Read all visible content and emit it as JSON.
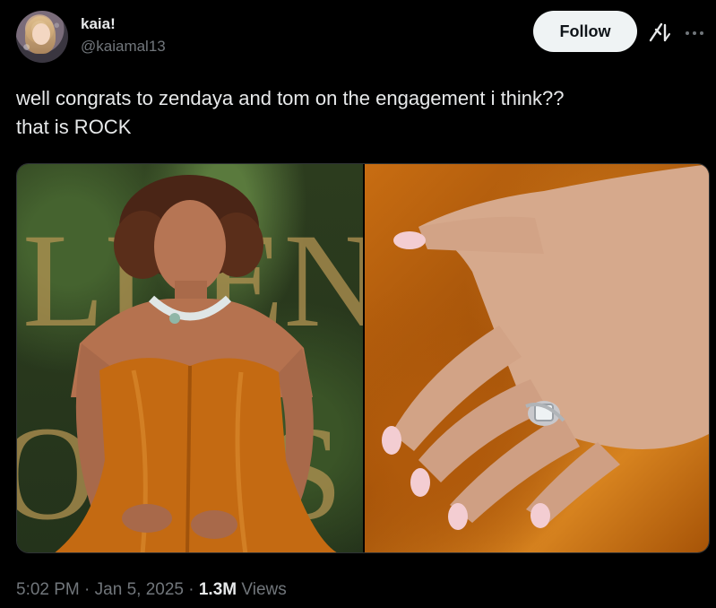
{
  "user": {
    "display_name": "kaia!",
    "handle": "@kaiamal13"
  },
  "header": {
    "follow_label": "Follow",
    "grok_icon": "grok-icon",
    "more_icon": "more-icon"
  },
  "tweet": {
    "text": "well congrats to zendaya and tom on the engagement i think??\nthat is ROCK"
  },
  "media": {
    "left_image": "woman-in-orange-satin-gown-photo",
    "right_image": "hand-with-ring-closeup-photo",
    "background_letters": [
      "LDEN",
      "OBES"
    ]
  },
  "footer": {
    "time": "5:02 PM",
    "sep1": " · ",
    "date": "Jan 5, 2025",
    "sep2": " · ",
    "views_count": "1.3M",
    "views_label": " Views"
  },
  "colors": {
    "background": "#000000",
    "text": "#e7e9ea",
    "muted": "#71767b",
    "follow_bg": "#eff3f4",
    "gown": "#c86d12"
  }
}
